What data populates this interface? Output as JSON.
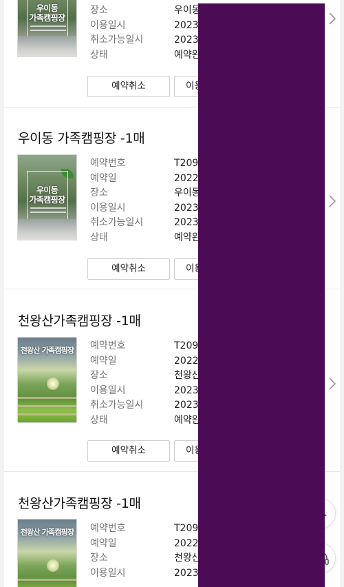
{
  "labels": {
    "reservation_no": "예약번호",
    "reservation_date": "예약일",
    "place": "장소",
    "use_date": "이용일시",
    "cancel_deadline": "취소가능일시",
    "status": "상태"
  },
  "buttons": {
    "cancel": "예약취소",
    "use_partial": "이용"
  },
  "cards": [
    {
      "title": "",
      "thumb_lines": [
        "우이동",
        "가족캠핑장"
      ],
      "rows": [
        {
          "label": "장소",
          "value": "우이동"
        },
        {
          "label": "이용일시",
          "value": "2023"
        },
        {
          "label": "취소가능일시",
          "value": "2023"
        },
        {
          "label": "상태",
          "value": "예약완"
        }
      ]
    },
    {
      "title": "우이동 가족캠핑장 -1매",
      "thumb_lines": [
        "우이동",
        "가족캠핑장"
      ],
      "rows": [
        {
          "label": "예약번호",
          "value": "T209"
        },
        {
          "label": "예약일",
          "value": "2022"
        },
        {
          "label": "장소",
          "value": "우이동"
        },
        {
          "label": "이용일시",
          "value": "2023"
        },
        {
          "label": "취소가능일시",
          "value": "2023"
        },
        {
          "label": "상태",
          "value": "예약완"
        }
      ]
    },
    {
      "title": "천왕산가족캠핑장 -1매",
      "thumb_lines": [
        "천왕산 가족캠핑장"
      ],
      "rows": [
        {
          "label": "예약번호",
          "value": "T209"
        },
        {
          "label": "예약일",
          "value": "2022"
        },
        {
          "label": "장소",
          "value": "천왕산"
        },
        {
          "label": "이용일시",
          "value": "2023"
        },
        {
          "label": "취소가능일시",
          "value": "2023"
        },
        {
          "label": "상태",
          "value": "예약완"
        }
      ]
    },
    {
      "title": "천왕산가족캠핑장 -1매",
      "thumb_lines": [
        "천왕산 가족캠핑장"
      ],
      "rows": [
        {
          "label": "예약번호",
          "value": "T209"
        },
        {
          "label": "예약일",
          "value": "2022"
        },
        {
          "label": "장소",
          "value": "천왕산"
        },
        {
          "label": "이용일시",
          "value": "2023"
        }
      ]
    }
  ],
  "icons": {
    "chevron": "chevron-right-icon",
    "scroll_top": "arrow-up-icon",
    "assistant": "headset-icon"
  },
  "colors": {
    "redaction": "#4b0c55",
    "divider": "#e6e6e6",
    "label": "#777777"
  }
}
